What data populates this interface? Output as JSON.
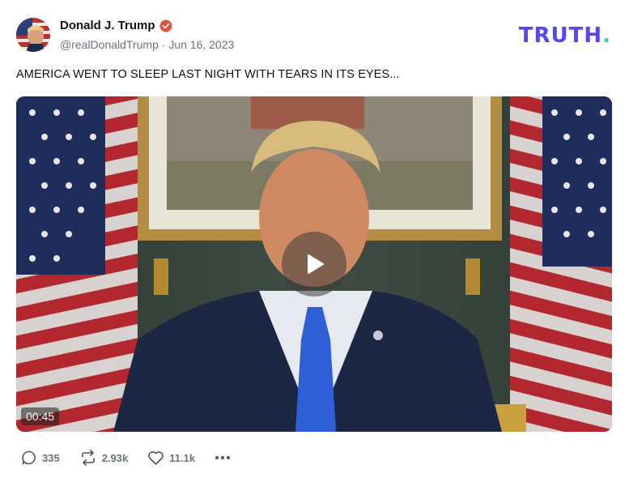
{
  "post": {
    "author_name": "Donald J. Trump",
    "handle": "@realDonaldTrump",
    "separator": "·",
    "date": "Jun 16, 2023",
    "text": "AMERICA WENT TO SLEEP LAST NIGHT WITH TEARS IN ITS EYES..."
  },
  "brand": {
    "logo_text": "TRUTH",
    "logo_dot": ".",
    "logo_color": "#5448ee",
    "dot_color": "#17e3b4"
  },
  "video": {
    "duration": "00:45"
  },
  "actions": {
    "replies": "335",
    "retruths": "2.93k",
    "likes": "11.1k"
  },
  "colors": {
    "verified": "#e0533d",
    "muted_text": "#6b7280"
  }
}
